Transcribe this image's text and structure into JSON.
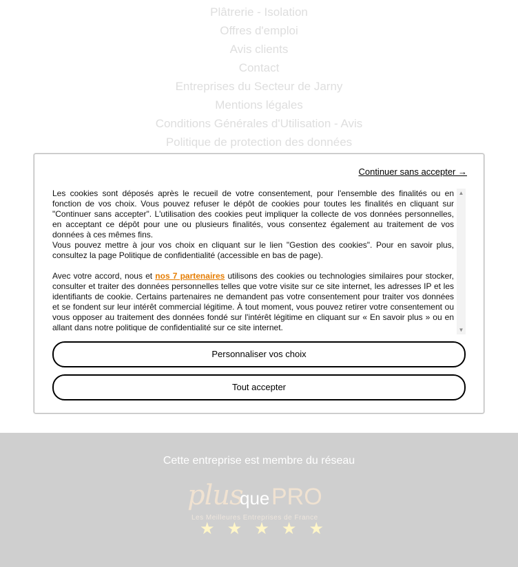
{
  "nav": {
    "items": [
      "Plâtrerie - Isolation",
      "Offres d'emploi",
      "Avis clients",
      "Contact",
      "Entreprises du Secteur de Jarny",
      "Mentions légales",
      "Conditions Générales d'Utilisation - Avis",
      "Politique de protection des données"
    ]
  },
  "cookie_modal": {
    "continue_label": "Continuer sans accepter →",
    "paragraph1": "Les cookies sont déposés après le recueil de votre consentement, pour l'ensemble des finalités ou en fonction de vos choix. Vous pouvez refuser le dépôt de cookies pour toutes les finalités en cliquant sur \"Continuer sans accepter\". L'utilisation des cookies peut impliquer la collecte de vos données personnelles, en acceptant ce dépôt pour une ou plusieurs finalités, vous consentez également au traitement de vos données à ces mêmes fins.",
    "paragraph2": "Vous pouvez mettre à jour vos choix en cliquant sur le lien \"Gestion des cookies\". Pour en savoir plus, consultez la page Politique de confidentialité (accessible en bas de page).",
    "paragraph3_before": "Avec votre accord, nous et ",
    "partners_link": "nos 7 partenaires",
    "paragraph3_after": " utilisons des cookies ou technologies similaires pour stocker, consulter et traiter des données personnelles telles que votre visite sur ce site internet, les adresses IP et les identifiants de cookie. Certains partenaires ne demandent pas votre consentement pour traiter vos données et se fondent sur leur intérêt commercial légitime. À tout moment, vous pouvez retirer votre consentement ou vous opposer au traitement des données fondé sur l'intérêt légitime en cliquant sur « En savoir plus » ou en allant dans notre politique de confidentialité sur ce site internet.",
    "customize_label": "Personnaliser vos choix",
    "accept_label": "Tout accepter",
    "partners_color": "#e57c00"
  },
  "footer": {
    "network_text": "Cette entreprise est membre du réseau",
    "logo_plus": "plus",
    "logo_que": "que",
    "logo_pro": "PRO",
    "logo_tagline": "Les Meilleures Entreprises de France",
    "stars_count": 5
  }
}
